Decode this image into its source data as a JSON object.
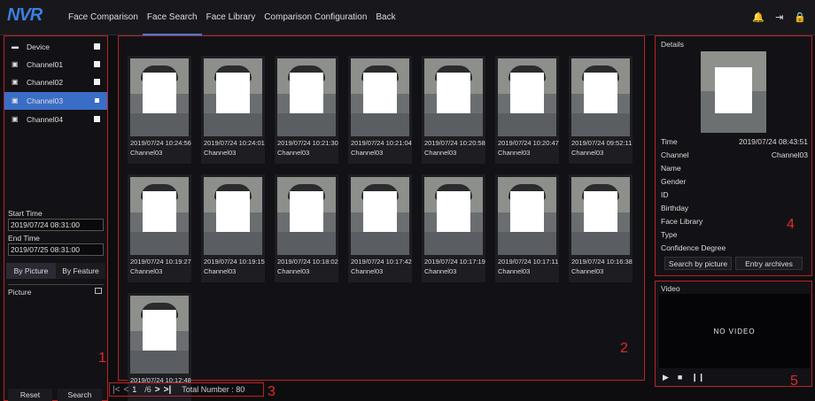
{
  "app": {
    "logo": "NVR"
  },
  "nav": {
    "tabs": [
      "Face Comparison",
      "Face Search",
      "Face Library",
      "Comparison Configuration",
      "Back"
    ],
    "active": "Face Search",
    "right_icons": [
      "bell-icon",
      "logout-icon",
      "lock-icon"
    ]
  },
  "devices": [
    {
      "label": "Device",
      "checked": true
    },
    {
      "label": "Channel01",
      "checked": true
    },
    {
      "label": "Channel02",
      "checked": true
    },
    {
      "label": "Channel03",
      "checked": true,
      "selected": true
    },
    {
      "label": "Channel04",
      "checked": true
    }
  ],
  "search": {
    "start_label": "Start Time",
    "start_value": "2019/07/24 08:31:00",
    "end_label": "End Time",
    "end_value": "2019/07/25 08:31:00",
    "mode_tabs": [
      "By Picture",
      "By Feature"
    ],
    "picture_label": "Picture",
    "reset_label": "Reset",
    "search_label": "Search"
  },
  "results": [
    {
      "time": "2019/07/24 10:24:56",
      "channel": "Channel03"
    },
    {
      "time": "2019/07/24 10:24:01",
      "channel": "Channel03"
    },
    {
      "time": "2019/07/24 10:21:30",
      "channel": "Channel03"
    },
    {
      "time": "2019/07/24 10:21:04",
      "channel": "Channel03"
    },
    {
      "time": "2019/07/24 10:20:58",
      "channel": "Channel03"
    },
    {
      "time": "2019/07/24 10:20:47",
      "channel": "Channel03"
    },
    {
      "time": "2019/07/24 09:52:11",
      "channel": "Channel03"
    },
    {
      "time": "2019/07/24 10:19:27",
      "channel": "Channel03"
    },
    {
      "time": "2019/07/24 10:19:15",
      "channel": "Channel03"
    },
    {
      "time": "2019/07/24 10:18:02",
      "channel": "Channel03"
    },
    {
      "time": "2019/07/24 10:17:42",
      "channel": "Channel03"
    },
    {
      "time": "2019/07/24 10:17:19",
      "channel": "Channel03"
    },
    {
      "time": "2019/07/24 10:17:11",
      "channel": "Channel03"
    },
    {
      "time": "2019/07/24 10:16:38",
      "channel": "Channel03"
    },
    {
      "time": "2019/07/24 10:12:48",
      "channel": ""
    }
  ],
  "pager": {
    "current": "1",
    "total_pages": "/6",
    "total_label": "Total Number : 80"
  },
  "details": {
    "title": "Details",
    "rows": [
      {
        "label": "Time",
        "value": "2019/07/24 08:43:51"
      },
      {
        "label": "Channel",
        "value": "Channel03"
      },
      {
        "label": "Name",
        "value": ""
      },
      {
        "label": "Gender",
        "value": ""
      },
      {
        "label": "ID",
        "value": ""
      },
      {
        "label": "Birthday",
        "value": ""
      },
      {
        "label": "Face Library",
        "value": ""
      },
      {
        "label": "Type",
        "value": ""
      },
      {
        "label": "Confidence Degree",
        "value": ""
      }
    ],
    "btn_search_picture": "Search by picture",
    "btn_archives": "Entry archives"
  },
  "video": {
    "title": "Video",
    "status": "NO VIDEO"
  },
  "markers": [
    "1",
    "2",
    "3",
    "4",
    "5"
  ],
  "colors": {
    "accent": "#3b7fe0",
    "marker": "#e02a2a",
    "selected_row": "#3a6ec6"
  }
}
